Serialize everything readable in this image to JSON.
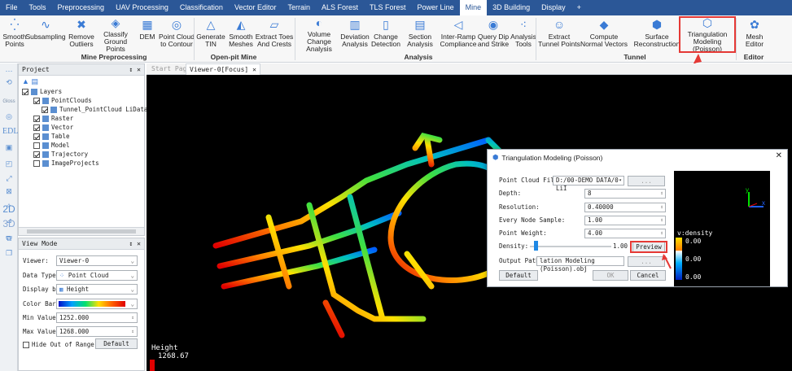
{
  "menu": [
    "File",
    "Tools",
    "Preprocessing",
    "UAV Processing",
    "Classification",
    "Vector Editor",
    "Terrain",
    "ALS Forest",
    "TLS Forest",
    "Power Line",
    "Mine",
    "3D Building",
    "Display",
    "+"
  ],
  "menu_active": "Mine",
  "ribbon": {
    "items": [
      "Smooth Points",
      "Subsampling",
      "Remove Outliers",
      "Classify Ground Points",
      "DEM",
      "Point Cloud to Contour",
      "Generate TIN",
      "Smooth Meshes",
      "Extract Toes And Crests",
      "Volume Change Analysis",
      "Deviation Analysis",
      "Change Detection",
      "Section Analysis",
      "Inter-Ramp Compliance",
      "Query Dip and Strike",
      "Analysis Tools",
      "Extract Tunnel Points",
      "Compute Normal Vectors",
      "Surface Reconstruction",
      "Triangulation Modeling (Poisson)",
      "Mesh Editor"
    ],
    "groups": [
      "Mine Preprocessing",
      "Open-pit Mine",
      "Analysis",
      "Tunnel",
      "Editor"
    ]
  },
  "left_toolbar": [
    "Gloss",
    "EDL",
    "2D",
    "3D"
  ],
  "project": {
    "title": "Project",
    "pin": "↕ ✕",
    "tree": [
      {
        "label": "Layers",
        "checked": true,
        "indent": 0
      },
      {
        "label": "PointClouds",
        "checked": true,
        "indent": 1
      },
      {
        "label": "Tunnel_PointCloud LiData",
        "checked": true,
        "indent": 2
      },
      {
        "label": "Raster",
        "checked": true,
        "indent": 1
      },
      {
        "label": "Vector",
        "checked": true,
        "indent": 1
      },
      {
        "label": "Table",
        "checked": true,
        "indent": 1
      },
      {
        "label": "Model",
        "checked": false,
        "indent": 1
      },
      {
        "label": "Trajectory",
        "checked": true,
        "indent": 1
      },
      {
        "label": "ImageProjects",
        "checked": false,
        "indent": 1
      }
    ]
  },
  "viewmode": {
    "title": "View Mode",
    "viewer_label": "Viewer:",
    "viewer": "Viewer-0",
    "datatype_label": "Data Type:",
    "datatype": "Point Cloud",
    "display_label": "Display by:",
    "display": "Height",
    "colorbar_label": "Color Bar:",
    "min_label": "Min Value:",
    "min": "1252.000",
    "max_label": "Max Value:",
    "max": "1268.000",
    "hide_label": "Hide Out of Range",
    "default_btn": "Default"
  },
  "tabs": [
    "Start Page",
    "Viewer-0[Focus]"
  ],
  "viewer": {
    "legend_title": "Height",
    "legend_value": "1268.67"
  },
  "dialog": {
    "title": "Triangulation Modeling (Poisson)",
    "pcfile_label": "Point Cloud File:",
    "pcfile": "D:/00-DEMO DATA/0-LiI",
    "depth_label": "Depth:",
    "depth": "8",
    "resolution_label": "Resolution:",
    "resolution": "0.40000",
    "every_label": "Every Node Sample:",
    "every": "1.00",
    "weight_label": "Point Weight:",
    "weight": "4.00",
    "density_label": "Density:",
    "density": "1.00",
    "density_frac": 0.05,
    "output_label": "Output Path:",
    "output": "lation Modeling (Poisson).obj",
    "browse": "...",
    "preview": "Preview",
    "default": "Default",
    "ok": "OK",
    "cancel": "Cancel",
    "preview_label": "v:density",
    "preview_values": [
      "0.00",
      "0.00",
      "0.00"
    ],
    "axes_y": "y",
    "axes_x": "x"
  },
  "colors": {
    "menubar": "#2b5797",
    "highlight": "#e53935"
  }
}
